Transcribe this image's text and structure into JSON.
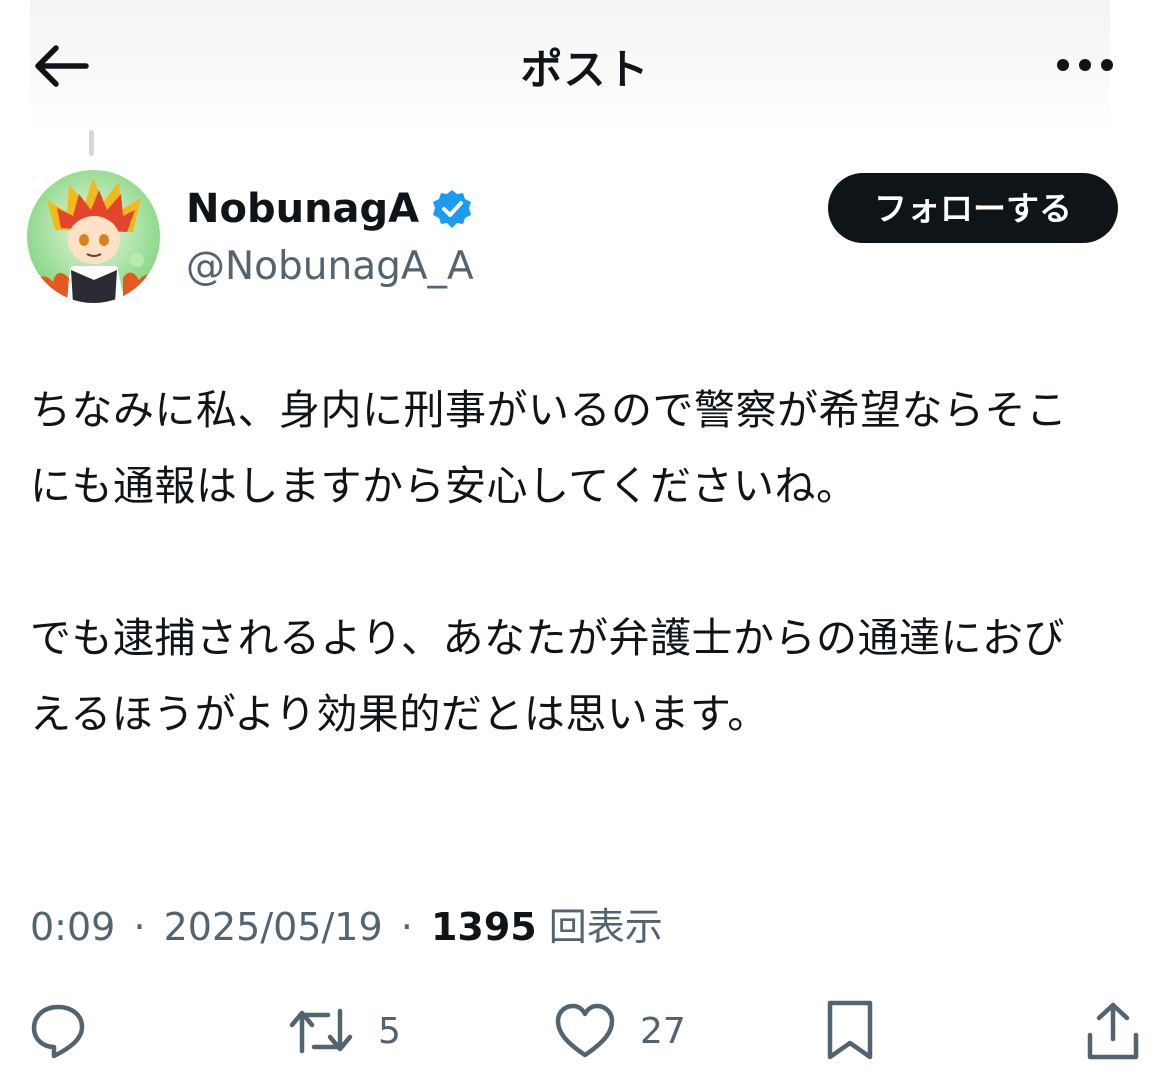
{
  "header": {
    "title": "ポスト"
  },
  "author": {
    "display_name": "NobunagA",
    "handle": "@NobunagA_A",
    "verified": true,
    "follow_label": "フォローする"
  },
  "post": {
    "paragraphs": [
      "ちなみに私、身内に刑事がいるので警察が希望ならそこにも通報はしますから安心してくださいね。",
      "でも逮捕されるより、あなたが弁護士からの通達におびえるほうがより効果的だとは思います。"
    ],
    "time": "0:09",
    "date": "2025/05/19",
    "separator": "·",
    "views_count": "1395",
    "views_label": "回表示"
  },
  "actions": {
    "reply_count": "",
    "repost_count": "5",
    "like_count": "27"
  },
  "colors": {
    "text": "#0f1419",
    "secondary": "#536471",
    "verified": "#1d9bf0",
    "follow_bg": "#0f1419"
  },
  "icons": [
    "back-arrow-icon",
    "more-icon",
    "verified-badge-icon",
    "reply-icon",
    "repost-icon",
    "like-icon",
    "bookmark-icon",
    "share-icon"
  ]
}
